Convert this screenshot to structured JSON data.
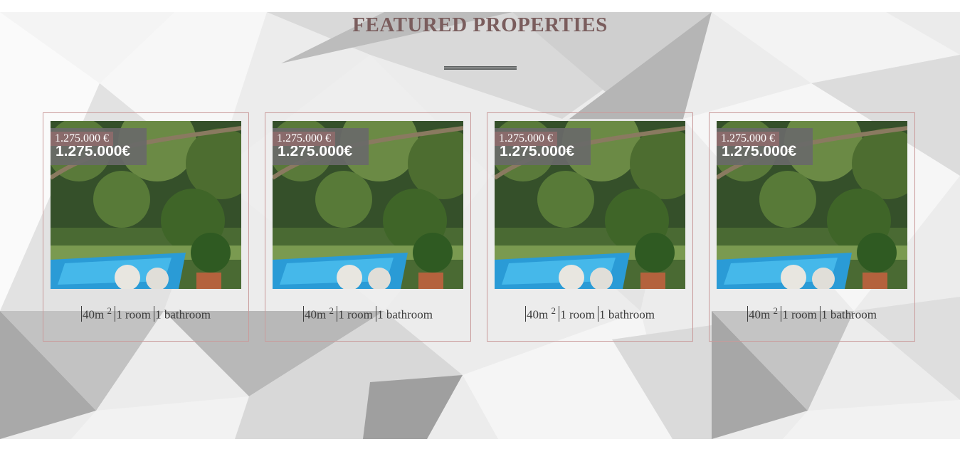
{
  "section": {
    "title": "FEATURED PROPERTIES"
  },
  "colors": {
    "title": "#7a5d5d",
    "card_border": "#c99a9a",
    "price_tag": "#8a6b6b"
  },
  "properties": [
    {
      "price_tag": "1.275.000 €",
      "price_overlay": "1.275.000€",
      "area": "40m",
      "area_unit_sup": "2",
      "rooms": "1 room",
      "bathrooms": "1 bathroom"
    },
    {
      "price_tag": "1.275.000 €",
      "price_overlay": "1.275.000€",
      "area": "40m",
      "area_unit_sup": "2",
      "rooms": "1 room",
      "bathrooms": "1 bathroom"
    },
    {
      "price_tag": "1.275.000 €",
      "price_overlay": "1.275.000€",
      "area": "40m",
      "area_unit_sup": "2",
      "rooms": "1 room",
      "bathrooms": "1 bathroom"
    },
    {
      "price_tag": "1.275.000 €",
      "price_overlay": "1.275.000€",
      "area": "40m",
      "area_unit_sup": "2",
      "rooms": "1 room",
      "bathrooms": "1 bathroom"
    }
  ]
}
